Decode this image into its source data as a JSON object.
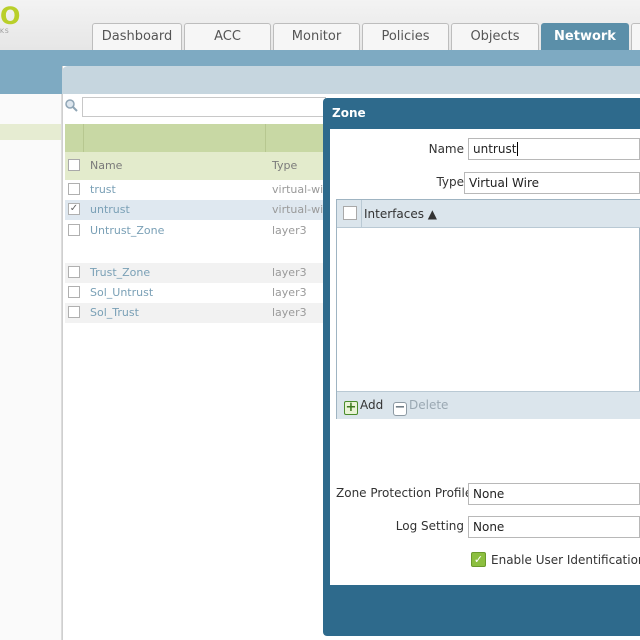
{
  "header": {
    "logo_text": "O",
    "logo_sub": "KS",
    "tabs": [
      {
        "label": "Dashboard"
      },
      {
        "label": "ACC"
      },
      {
        "label": "Monitor"
      },
      {
        "label": "Policies"
      },
      {
        "label": "Objects"
      },
      {
        "label": "Network"
      }
    ],
    "active_tab": "Network"
  },
  "zones_table": {
    "search": {
      "value": "",
      "placeholder": ""
    },
    "columns": {
      "name": "Name",
      "type": "Type"
    },
    "rows": [
      {
        "name": "trust",
        "type": "virtual-wire",
        "checked": false,
        "selected": false
      },
      {
        "name": "untrust",
        "type": "virtual-wire",
        "checked": true,
        "selected": true
      },
      {
        "name": "Untrust_Zone",
        "type": "layer3",
        "checked": false,
        "selected": false
      },
      {
        "name": "Trust_Zone",
        "type": "layer3",
        "checked": false,
        "selected": false
      },
      {
        "name": "Sol_Untrust",
        "type": "layer3",
        "checked": false,
        "selected": false
      },
      {
        "name": "Sol_Trust",
        "type": "layer3",
        "checked": false,
        "selected": false
      }
    ]
  },
  "dialog": {
    "title": "Zone",
    "name_label": "Name",
    "name_value": "untrust",
    "type_label": "Type",
    "type_value": "Virtual Wire",
    "interfaces_header": "Interfaces ▲",
    "add_label": "Add",
    "delete_label": "Delete",
    "zone_protection_label": "Zone Protection Profile",
    "zone_protection_value": "None",
    "log_setting_label": "Log Setting",
    "log_setting_value": "None",
    "enable_user_id_label": "Enable User Identification",
    "enable_user_id_checked": true
  },
  "colors": {
    "accent_green": "#b9cf2a",
    "active_tab": "#5b8fa9",
    "dialog_title_bar": "#2e6a8c",
    "row_link": "#7aa0b6"
  },
  "icons": {
    "search": "search-icon",
    "add": "plus-icon",
    "delete": "minus-icon",
    "sort": "sort-ascending-icon"
  }
}
